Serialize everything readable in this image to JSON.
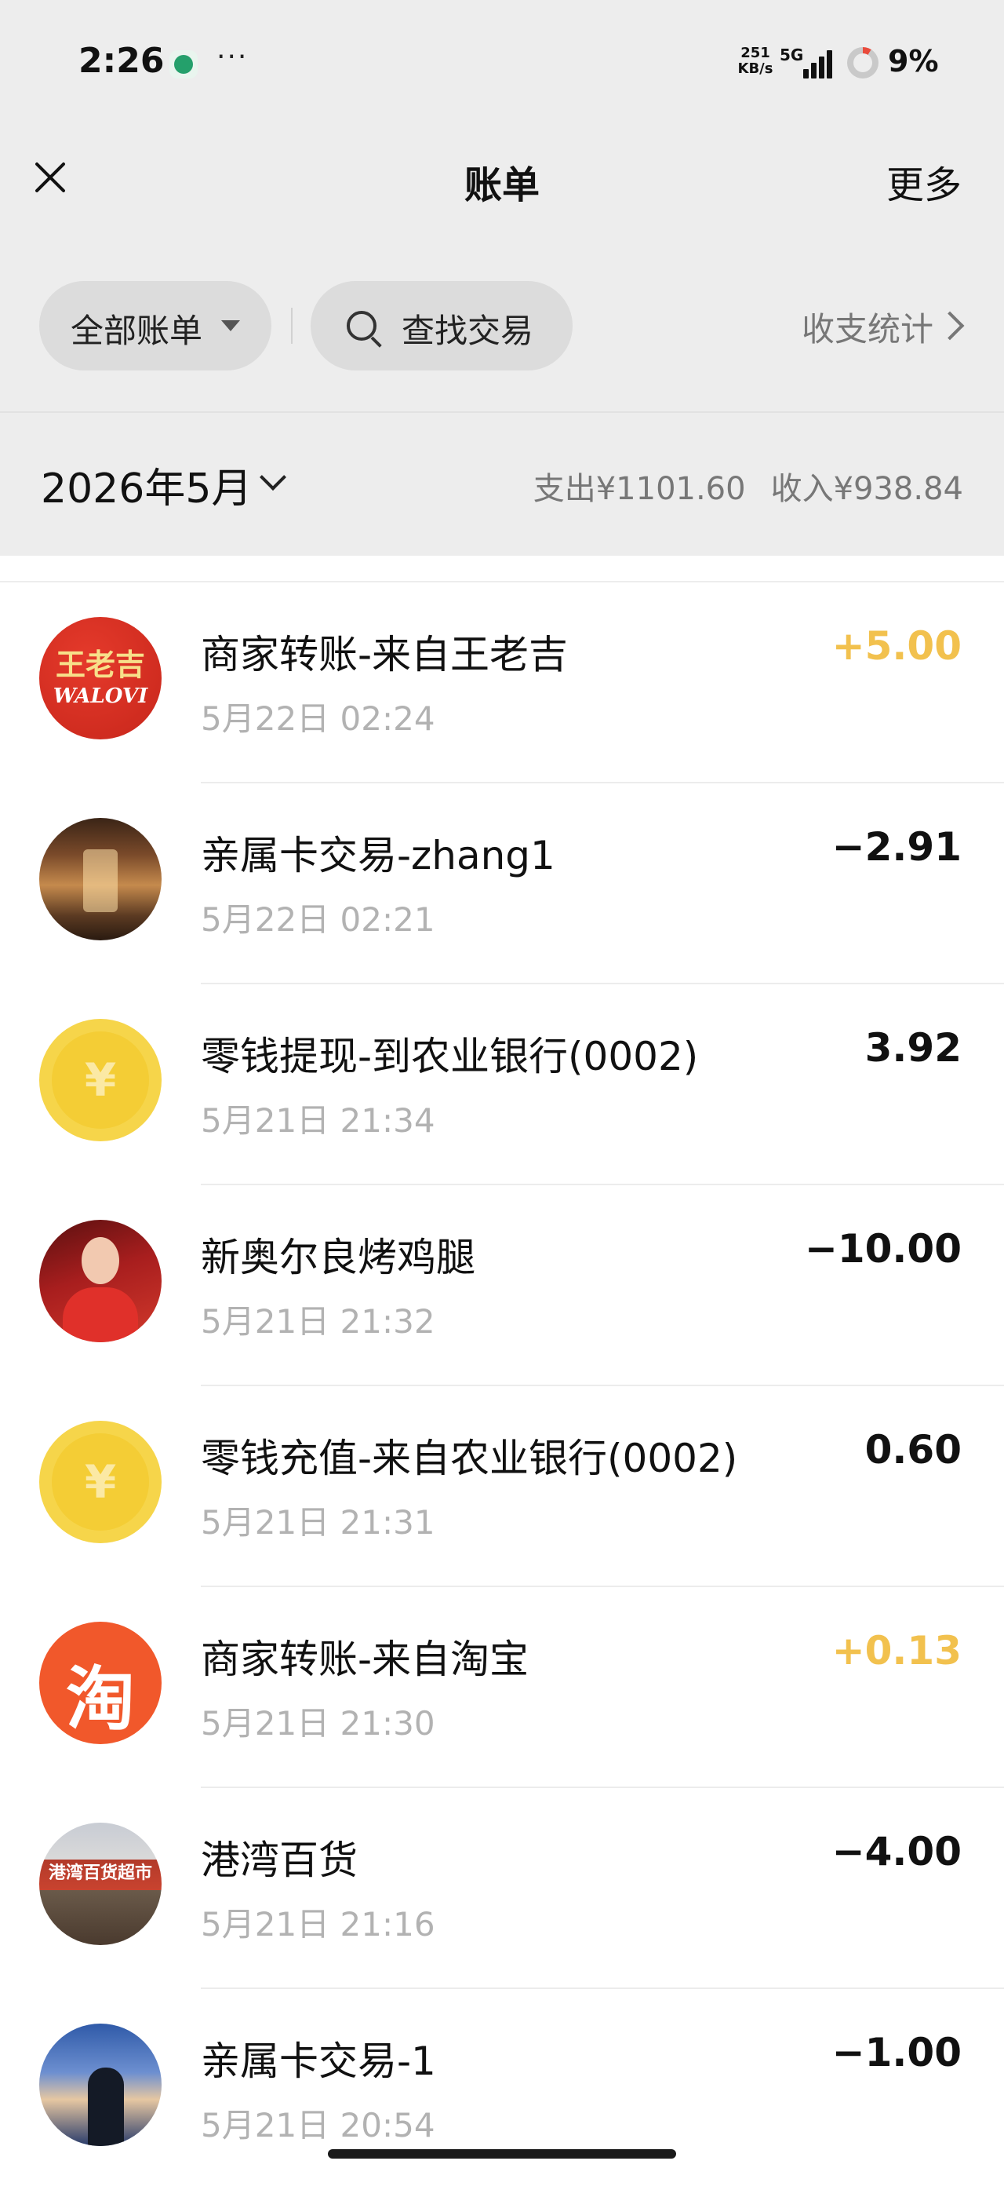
{
  "status_bar": {
    "time": "2:26",
    "dots": "···",
    "net_speed_value": "251",
    "net_speed_unit": "KB/s",
    "network": "5G",
    "battery": "9%",
    "battery_fraction": 0.09
  },
  "nav": {
    "title": "账单",
    "more": "更多"
  },
  "filters": {
    "all_bills": "全部账单",
    "search": "查找交易",
    "stats": "收支统计"
  },
  "month": {
    "label": "2026年5月",
    "expense": "支出¥1101.60",
    "income": "收入¥938.84"
  },
  "transactions": [
    {
      "title": "商家转账-来自王老吉",
      "time": "5月22日 02:24",
      "amount": "+5.00",
      "avatar": "wanglaoji-logo",
      "logo_text_1": "王老吉",
      "logo_text_2": "WALOVI",
      "income": true
    },
    {
      "title": "亲属卡交易-zhang1",
      "time": "5月22日 02:21",
      "amount": "−2.91",
      "avatar": "stage-photo",
      "income": false
    },
    {
      "title": "零钱提现-到农业银行(0002)",
      "time": "5月21日 21:34",
      "amount": "3.92",
      "avatar": "coin-icon",
      "income": false
    },
    {
      "title": "新奥尔良烤鸡腿",
      "time": "5月21日 21:32",
      "amount": "−10.00",
      "avatar": "woman-photo",
      "income": false
    },
    {
      "title": "零钱充值-来自农业银行(0002)",
      "time": "5月21日 21:31",
      "amount": "0.60",
      "avatar": "coin-icon",
      "income": false
    },
    {
      "title": "商家转账-来自淘宝",
      "time": "5月21日 21:30",
      "amount": "+0.13",
      "avatar": "taobao-logo",
      "logo_text_1": "淘",
      "income": true
    },
    {
      "title": "港湾百货",
      "time": "5月21日 21:16",
      "amount": "−4.00",
      "avatar": "store-photo",
      "logo_text_1": "港湾百货超市",
      "income": false
    },
    {
      "title": "亲属卡交易-1",
      "time": "5月21日 20:54",
      "amount": "−1.00",
      "avatar": "dusk-photo",
      "income": false
    }
  ],
  "colors": {
    "income_amount": "#f2c14e",
    "header_bg": "#ededed",
    "coin_yellow": "#f6d54a",
    "taobao_orange": "#f1582b"
  }
}
